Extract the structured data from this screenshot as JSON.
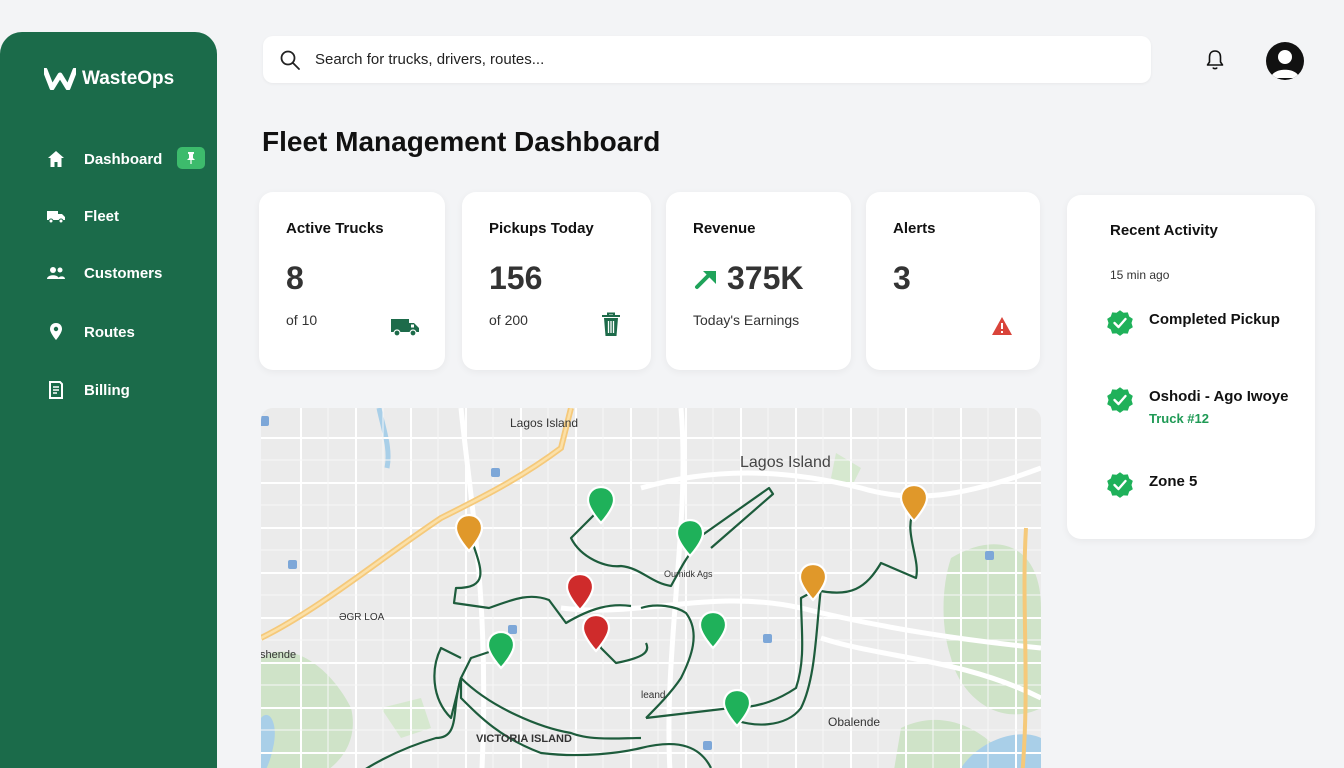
{
  "app": {
    "name": "WasteOps"
  },
  "sidebar": {
    "items": [
      {
        "label": "Dashboard",
        "icon": "home-icon"
      },
      {
        "label": "Fleet",
        "icon": "truck-icon"
      },
      {
        "label": "Customers",
        "icon": "users-icon"
      },
      {
        "label": "Routes",
        "icon": "location-pin-icon"
      },
      {
        "label": "Billing",
        "icon": "document-icon"
      }
    ]
  },
  "search": {
    "placeholder": "Search for trucks, drivers, routes..."
  },
  "page": {
    "title": "Fleet Management Dashboard"
  },
  "cards": [
    {
      "label": "Active Trucks",
      "value": "8",
      "sub": "of 10",
      "icon": "truck-icon"
    },
    {
      "label": "Pickups Today",
      "value": "156",
      "sub": "of 200",
      "icon": "trash-icon"
    },
    {
      "label": "Revenue",
      "value": "375K",
      "sub": "Today's Earnings",
      "icon": "trend-up-icon"
    },
    {
      "label": "Alerts",
      "value": "3",
      "sub": "",
      "icon": "warning-icon"
    }
  ],
  "activity": {
    "title": "Recent Activity",
    "time": "15 min ago",
    "items": [
      {
        "text": "Completed Pickup",
        "sub": ""
      },
      {
        "text": "Oshodi - Ago Iwoye",
        "sub": "Truck #12"
      },
      {
        "text": "Zone 5",
        "sub": ""
      }
    ]
  },
  "map": {
    "labels": {
      "lagos_island_top": "Lagos Island",
      "lagos_island_center": "Lagos Island",
      "victoria_island": "VICTORIA ISLAND",
      "obalende": "Obalende",
      "shende": "shende",
      "ugr_loa": "ƏGR LOA",
      "leand": "leand",
      "oumidk_ags": "Oumidk Ags"
    },
    "markers": [
      {
        "status": "completed",
        "color": "#1fb15a"
      },
      {
        "status": "completed",
        "color": "#1fb15a"
      },
      {
        "status": "completed",
        "color": "#1fb15a"
      },
      {
        "status": "completed",
        "color": "#1fb15a"
      },
      {
        "status": "completed",
        "color": "#1fb15a"
      },
      {
        "status": "pending",
        "color": "#e0982a"
      },
      {
        "status": "pending",
        "color": "#e0982a"
      },
      {
        "status": "pending",
        "color": "#e0982a"
      },
      {
        "status": "alert",
        "color": "#cf2b2b"
      },
      {
        "status": "alert",
        "color": "#cf2b2b"
      }
    ]
  },
  "colors": {
    "sidebar": "#1b6b4a",
    "accent": "#1f9a55",
    "route": "#1d5c3c",
    "warning": "#d9443a"
  }
}
